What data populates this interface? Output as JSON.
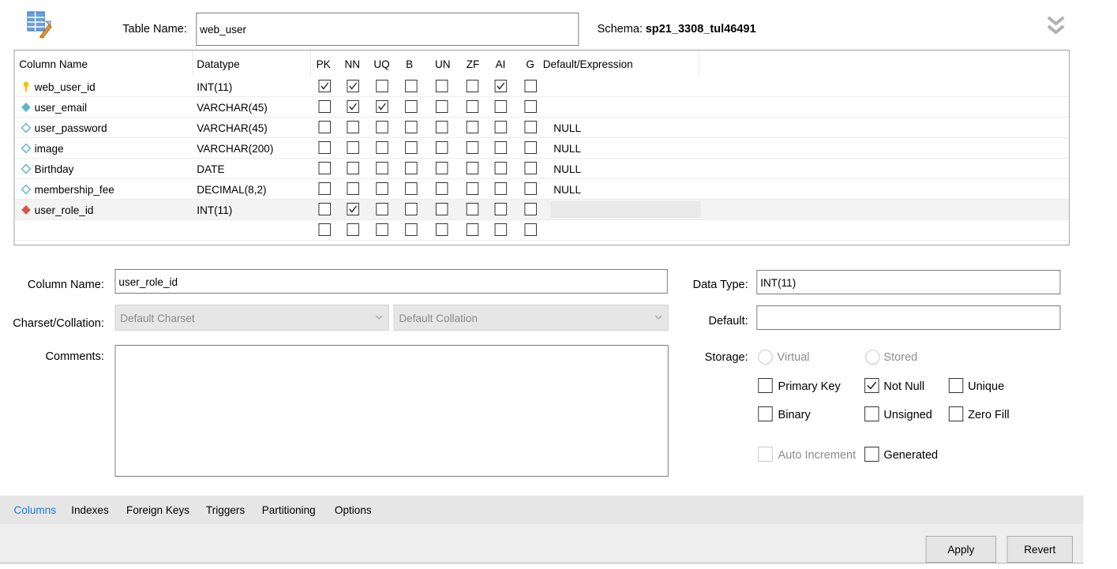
{
  "header": {
    "table_name_label": "Table Name:",
    "table_name_value": "web_user",
    "schema_label": "Schema:",
    "schema_value": "sp21_3308_tul46491"
  },
  "grid": {
    "headers": [
      "Column Name",
      "Datatype",
      "PK",
      "NN",
      "UQ",
      "B",
      "UN",
      "ZF",
      "AI",
      "G",
      "Default/Expression"
    ],
    "rows": [
      {
        "name": "web_user_id",
        "type": "INT(11)",
        "icon": "primary-key-icon",
        "flags": [
          1,
          1,
          0,
          0,
          0,
          0,
          1,
          0
        ],
        "default": ""
      },
      {
        "name": "user_email",
        "type": "VARCHAR(45)",
        "icon": "column-not-null-icon",
        "flags": [
          0,
          1,
          1,
          0,
          0,
          0,
          0,
          0
        ],
        "default": ""
      },
      {
        "name": "user_password",
        "type": "VARCHAR(45)",
        "icon": "column-nullable-icon",
        "flags": [
          0,
          0,
          0,
          0,
          0,
          0,
          0,
          0
        ],
        "default": "NULL"
      },
      {
        "name": "image",
        "type": "VARCHAR(200)",
        "icon": "column-nullable-icon",
        "flags": [
          0,
          0,
          0,
          0,
          0,
          0,
          0,
          0
        ],
        "default": "NULL"
      },
      {
        "name": "Birthday",
        "type": "DATE",
        "icon": "column-nullable-icon",
        "flags": [
          0,
          0,
          0,
          0,
          0,
          0,
          0,
          0
        ],
        "default": "NULL"
      },
      {
        "name": "membership_fee",
        "type": "DECIMAL(8,2)",
        "icon": "column-nullable-icon",
        "flags": [
          0,
          0,
          0,
          0,
          0,
          0,
          0,
          0
        ],
        "default": "NULL"
      },
      {
        "name": "user_role_id",
        "type": "INT(11)",
        "icon": "foreign-key-icon",
        "flags": [
          0,
          1,
          0,
          0,
          0,
          0,
          0,
          0
        ],
        "default": ""
      },
      {
        "name": "",
        "type": "",
        "icon": "",
        "flags": [
          0,
          0,
          0,
          0,
          0,
          0,
          0,
          0
        ],
        "default": ""
      }
    ]
  },
  "details": {
    "column_name_label": "Column Name:",
    "column_name_value": "user_role_id",
    "charset_label": "Charset/Collation:",
    "charset_value": "Default Charset",
    "collation_value": "Default Collation",
    "comments_label": "Comments:",
    "comments_value": "",
    "data_type_label": "Data Type:",
    "data_type_value": "INT(11)",
    "default_label": "Default:",
    "default_value": "",
    "storage_label": "Storage:",
    "virtual_label": "Virtual",
    "stored_label": "Stored",
    "primary_key_label": "Primary Key",
    "not_null_label": "Not Null",
    "unique_label": "Unique",
    "binary_label": "Binary",
    "unsigned_label": "Unsigned",
    "zero_fill_label": "Zero Fill",
    "auto_increment_label": "Auto Increment",
    "generated_label": "Generated",
    "checks": {
      "primary_key": false,
      "not_null": true,
      "unique": false,
      "binary": false,
      "unsigned": false,
      "zero_fill": false,
      "auto_increment": false,
      "generated": false
    }
  },
  "tabs": [
    "Columns",
    "Indexes",
    "Foreign Keys",
    "Triggers",
    "Partitioning",
    "Options"
  ],
  "active_tab": "Columns",
  "buttons": {
    "apply": "Apply",
    "revert": "Revert"
  },
  "colors": {
    "accent": "#1b7bd4",
    "pk_key": "#f2c200",
    "fk_diamond": "#d9534f",
    "column_diamond": "#5fb6c7"
  }
}
